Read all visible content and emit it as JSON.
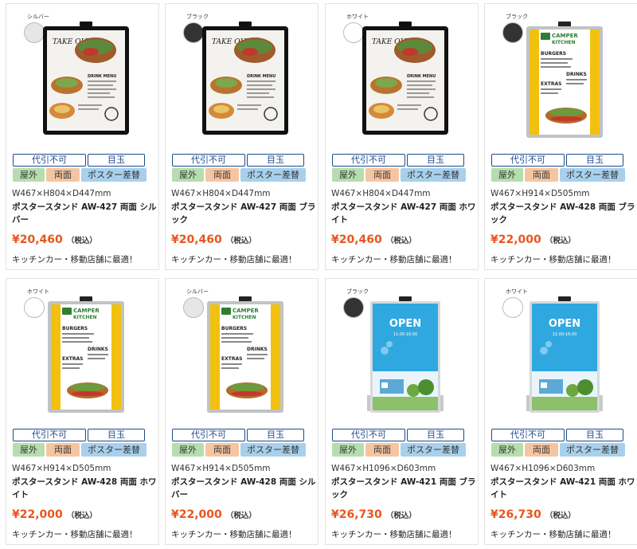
{
  "tags": {
    "daibiki": "代引不可",
    "medama": "目玉",
    "okugai": "屋外",
    "ryomen": "両面",
    "poster": "ポスター差替"
  },
  "products": [
    {
      "color_label": "シルバー",
      "swatch": "#e4e6e8",
      "image": "aw427-black-frame-takeout-poster",
      "size": "W467×H804×D447mm",
      "name": "ポスタースタンド AW-427 両面 シルバー",
      "price": "¥20,460",
      "tax": "（税込）",
      "catch": "キッチンカー・移動店舗に最適！"
    },
    {
      "color_label": "ブラック",
      "swatch": "#333333",
      "image": "aw427-black-frame-takeout-poster",
      "size": "W467×H804×D447mm",
      "name": "ポスタースタンド AW-427 両面 ブラック",
      "price": "¥20,460",
      "tax": "（税込）",
      "catch": "キッチンカー・移動店舗に最適！"
    },
    {
      "color_label": "ホワイト",
      "swatch": "#ffffff",
      "image": "aw427-black-frame-takeout-poster",
      "size": "W467×H804×D447mm",
      "name": "ポスタースタンド AW-427 両面 ホワイト",
      "price": "¥20,460",
      "tax": "（税込）",
      "catch": "キッチンカー・移動店舗に最適！"
    },
    {
      "color_label": "ブラック",
      "swatch": "#333333",
      "image": "aw428-silver-frame-camper-poster",
      "size": "W467×H914×D505mm",
      "name": "ポスタースタンド AW-428 両面 ブラック",
      "price": "¥22,000",
      "tax": "（税込）",
      "catch": "キッチンカー・移動店舗に最適！"
    },
    {
      "color_label": "ホワイト",
      "swatch": "#ffffff",
      "image": "aw428-silver-frame-camper-poster",
      "size": "W467×H914×D505mm",
      "name": "ポスタースタンド AW-428 両面 ホワイト",
      "price": "¥22,000",
      "tax": "（税込）",
      "catch": "キッチンカー・移動店舗に最適！"
    },
    {
      "color_label": "シルバー",
      "swatch": "#e4e6e8",
      "image": "aw428-silver-frame-camper-poster",
      "size": "W467×H914×D505mm",
      "name": "ポスタースタンド AW-428 両面 シルバー",
      "price": "¥22,000",
      "tax": "（税込）",
      "catch": "キッチンカー・移動店舗に最適！"
    },
    {
      "color_label": "ブラック",
      "swatch": "#333333",
      "image": "aw421-open-sign-poster",
      "size": "W467×H1096×D603mm",
      "name": "ポスタースタンド AW-421 両面 ブラック",
      "price": "¥26,730",
      "tax": "（税込）",
      "catch": "キッチンカー・移動店舗に最適！"
    },
    {
      "color_label": "ホワイト",
      "swatch": "#ffffff",
      "image": "aw421-open-sign-poster",
      "size": "W467×H1096×D603mm",
      "name": "ポスタースタンド AW-421 両面 ホワイト",
      "price": "¥26,730",
      "tax": "（税込）",
      "catch": "キッチンカー・移動店舗に最適！"
    }
  ],
  "poster_text": {
    "takeout": "TAKE OUT",
    "drink_menu": "DRINK MENU",
    "camper": "CAMPER",
    "kitchen": "KITCHEN",
    "burgers": "BURGERS",
    "drinks": "DRINKS",
    "extras": "EXTRAS",
    "open": "OPEN",
    "hours": "11:00-16:00"
  }
}
